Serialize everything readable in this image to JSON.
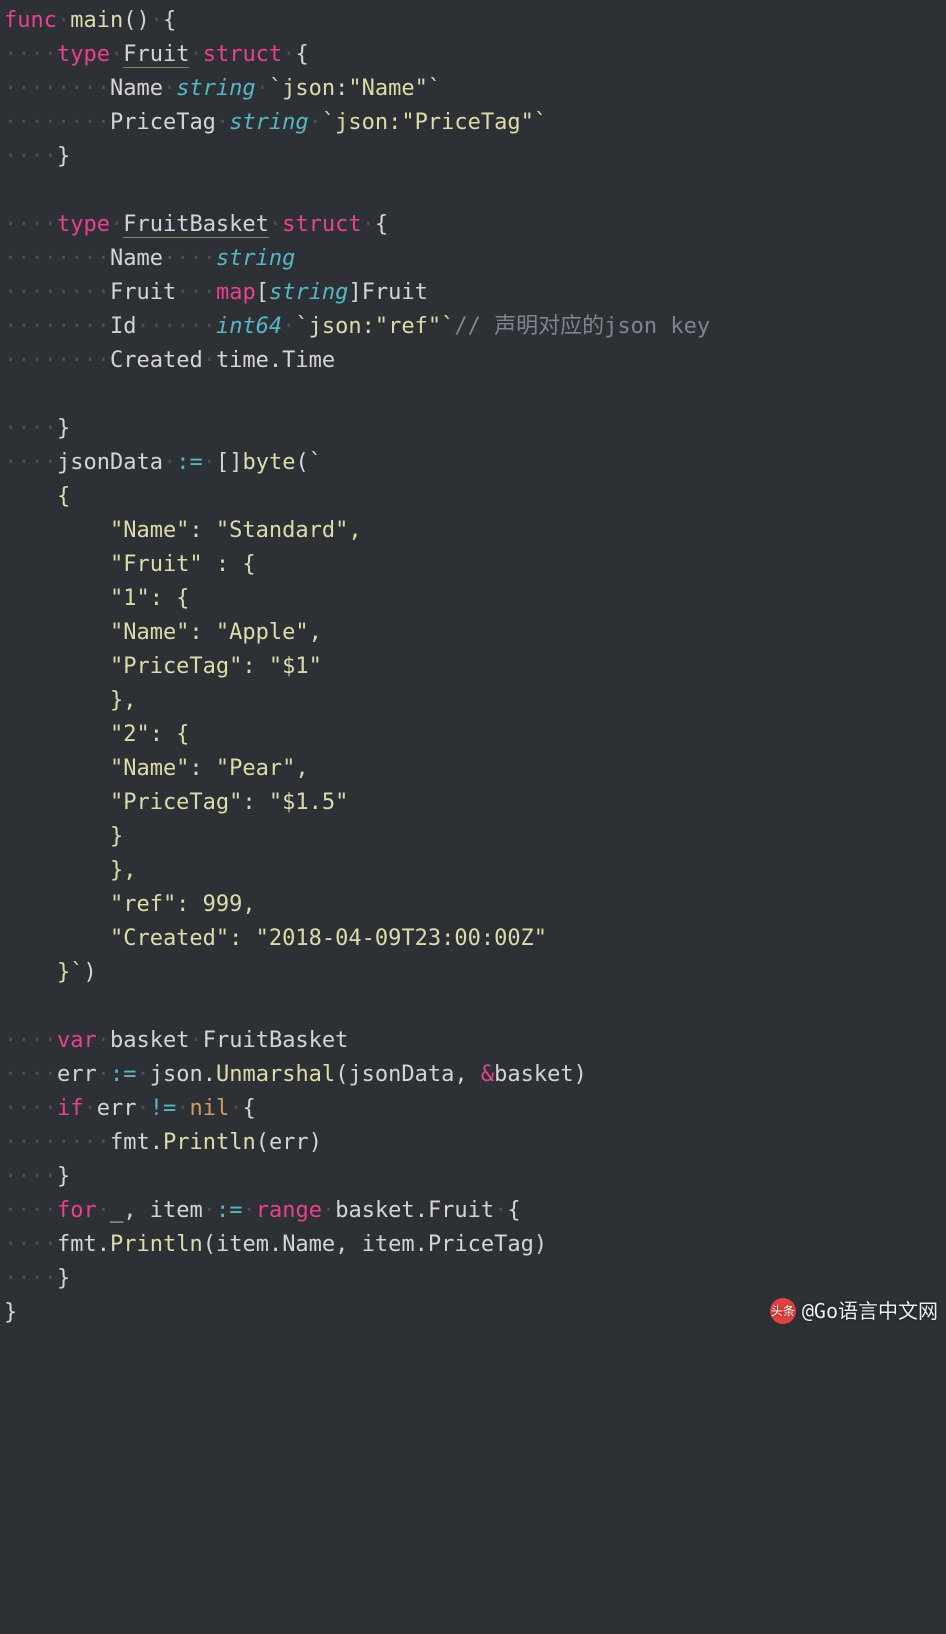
{
  "code": {
    "line1": {
      "kw_func": "func",
      "name": "main",
      "parens": "()",
      "brace": "{"
    },
    "line2": {
      "kw_type": "type",
      "name": "Fruit",
      "kw_struct": "struct",
      "brace": "{"
    },
    "line3": {
      "field": "Name",
      "type": "string",
      "tag": "`json:\"Name\"`"
    },
    "line4": {
      "field": "PriceTag",
      "type": "string",
      "tag": "`json:\"PriceTag\"`"
    },
    "line5": {
      "brace": "}"
    },
    "line7": {
      "kw_type": "type",
      "name": "FruitBasket",
      "kw_struct": "struct",
      "brace": "{"
    },
    "line8": {
      "field": "Name",
      "type": "string"
    },
    "line9": {
      "field": "Fruit",
      "kw_map": "map",
      "lb": "[",
      "keytype": "string",
      "rb": "]",
      "valtype": "Fruit"
    },
    "line10": {
      "field": "Id",
      "type": "int64",
      "tag": "`json:\"ref\"`",
      "cmt": "// 声明对应的json key"
    },
    "line11": {
      "field": "Created",
      "pkg": "time",
      "dot": ".",
      "typename": "Time"
    },
    "line13": {
      "brace": "}"
    },
    "line14": {
      "ident": "jsonData",
      "assign": ":=",
      "lb": "[]",
      "fn": "byte",
      "paren": "(",
      "tick": "`"
    },
    "line15": {
      "text": "    {"
    },
    "line16": {
      "text": "        \"Name\": \"Standard\","
    },
    "line17": {
      "text": "        \"Fruit\" : {"
    },
    "line18": {
      "text": "        \"1\": {"
    },
    "line19": {
      "text": "        \"Name\": \"Apple\","
    },
    "line20": {
      "text": "        \"PriceTag\": \"$1\""
    },
    "line21": {
      "text": "        },"
    },
    "line22": {
      "text": "        \"2\": {"
    },
    "line23": {
      "text": "        \"Name\": \"Pear\","
    },
    "line24": {
      "text": "        \"PriceTag\": \"$1.5\""
    },
    "line25": {
      "text": "        }"
    },
    "line26": {
      "text": "        },"
    },
    "line27": {
      "text": "        \"ref\": 999,"
    },
    "line28": {
      "text": "        \"Created\": \"2018-04-09T23:00:00Z\""
    },
    "line29": {
      "text": "    }`",
      ")": ")"
    },
    "line31": {
      "kw_var": "var",
      "ident": "basket",
      "type": "FruitBasket"
    },
    "line32": {
      "ident": "err",
      "assign": ":=",
      "pkg": "json",
      "dot": ".",
      "fn": "Unmarshal",
      "open": "(",
      "arg1": "jsonData",
      "comma": ", ",
      "amp": "&",
      "arg2": "basket",
      "close": ")"
    },
    "line33": {
      "kw_if": "if",
      "ident": "err",
      "neq": "!=",
      "nil": "nil",
      "brace": "{"
    },
    "line34": {
      "pkg": "fmt",
      "dot": ".",
      "fn": "Println",
      "open": "(",
      "arg": "err",
      "close": ")"
    },
    "line35": {
      "brace": "}"
    },
    "line36": {
      "kw_for": "for",
      "us": "_",
      "comma": ", ",
      "ident": "item",
      "assign": ":=",
      "kw_range": "range",
      "obj": "basket",
      "dot": ".",
      "field": "Fruit",
      "brace": "{"
    },
    "line37": {
      "pkg": "fmt",
      "dot": ".",
      "fn": "Println",
      "open": "(",
      "a1": "item",
      "d1": ".",
      "f1": "Name",
      "c": ", ",
      "a2": "item",
      "d2": ".",
      "f2": "PriceTag",
      "close": ")"
    },
    "line38": {
      "brace": "}"
    },
    "line39": {
      "brace": "}"
    }
  },
  "watermark": {
    "logo": "头条",
    "text": "@Go语言中文网"
  }
}
